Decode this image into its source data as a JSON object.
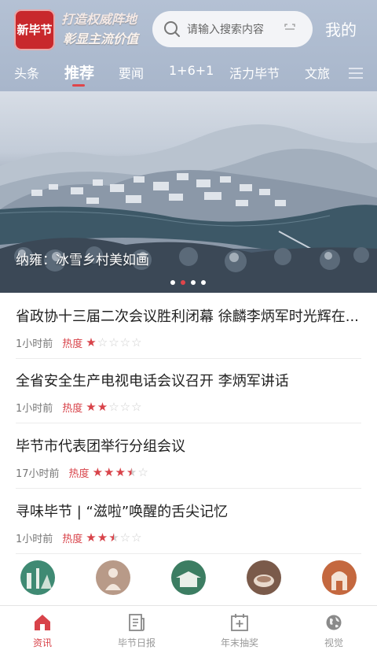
{
  "header": {
    "logo_text": "新毕节",
    "slogan_line1": "打造权威阵地",
    "slogan_line2": "彰显主流价值",
    "search_placeholder": "请输入搜索内容",
    "mine_label": "我的"
  },
  "tabs": [
    {
      "label": "头条",
      "active": false
    },
    {
      "label": "推荐",
      "active": true
    },
    {
      "label": "要闻",
      "active": false
    },
    {
      "label": "1+6+1",
      "active": false
    },
    {
      "label": "活力毕节",
      "active": false
    },
    {
      "label": "文旅",
      "active": false
    }
  ],
  "banner": {
    "caption": "纳雍：冰雪乡村美如画",
    "slide_count": 4,
    "active_slide": 2
  },
  "news": [
    {
      "title": "省政协十三届二次会议胜利闭幕 徐麟李炳军时光辉在...",
      "time": "1小时前",
      "heat_label": "热度",
      "stars": 1
    },
    {
      "title": "全省安全生产电视电话会议召开 李炳军讲话",
      "time": "1小时前",
      "heat_label": "热度",
      "stars": 2
    },
    {
      "title": "毕节市代表团举行分组会议",
      "time": "17小时前",
      "heat_label": "热度",
      "stars": 3.5
    },
    {
      "title": "寻味毕节 | “滋啦”唤醒的舌尖记忆",
      "time": "1小时前",
      "heat_label": "热度",
      "stars": 2.5
    }
  ],
  "bottom_nav": [
    {
      "label": "资讯",
      "icon": "home-icon",
      "active": true
    },
    {
      "label": "毕节日报",
      "icon": "newspaper-icon",
      "active": false
    },
    {
      "label": "年末抽奖",
      "icon": "calendar-plus-icon",
      "active": false
    },
    {
      "label": "视觉",
      "icon": "globe-icon",
      "active": false
    }
  ],
  "colors": {
    "accent": "#d8434a",
    "header_bg": "#aebbd0",
    "logo_bg": "#c8282c"
  }
}
